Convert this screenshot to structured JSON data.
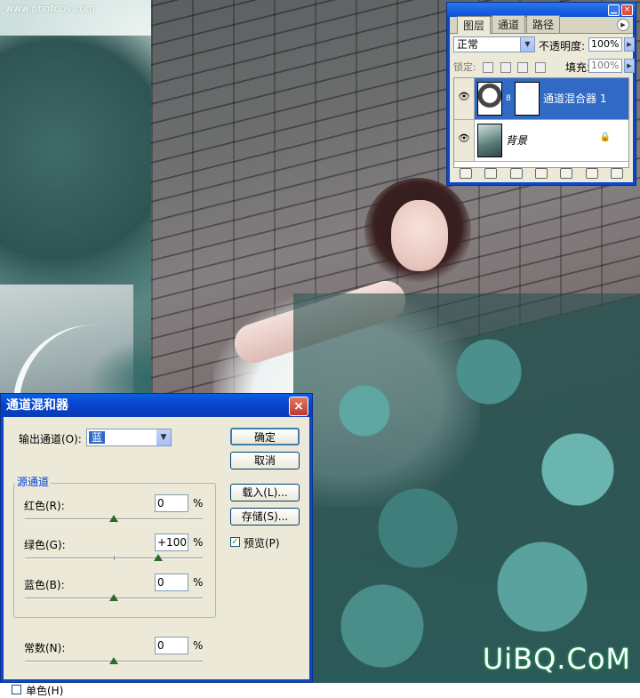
{
  "watermarks": {
    "top_url": "www.photops.com",
    "bottom_logo": "UiBQ.CoM"
  },
  "layers_panel": {
    "tabs": [
      "图层",
      "通道",
      "路径"
    ],
    "active_tab": "图层",
    "blend_mode": "正常",
    "opacity_label": "不透明度:",
    "opacity_value": "100%",
    "lock_label": "锁定:",
    "fill_label": "填充:",
    "fill_value": "100%",
    "layers": [
      {
        "name": "通道混合器 1",
        "selected": true,
        "thumb_icon": "adjustment-layer-icon",
        "has_mask": true
      },
      {
        "name": "背景",
        "selected": false,
        "thumb_icon": "photo-thumbnail",
        "locked": true
      }
    ],
    "window_controls": [
      "minimize",
      "close"
    ]
  },
  "channel_mixer": {
    "title": "通道混和器",
    "output_channel_label": "输出通道(O):",
    "output_channel_value": "蓝",
    "source_group_label": "源通道",
    "sliders": [
      {
        "key": "red",
        "label": "红色(R):",
        "value": "0",
        "unit": "%",
        "level": 0
      },
      {
        "key": "green",
        "label": "绿色(G):",
        "value": "+100",
        "unit": "%",
        "level": 100
      },
      {
        "key": "blue",
        "label": "蓝色(B):",
        "value": "0",
        "unit": "%",
        "level": 0
      }
    ],
    "constant": {
      "label": "常数(N):",
      "value": "0",
      "unit": "%",
      "level": 0
    },
    "monochrome_label": "单色(H)",
    "monochrome_checked": false,
    "buttons": {
      "ok": "确定",
      "cancel": "取消",
      "load": "载入(L)...",
      "save": "存储(S)..."
    },
    "preview_label": "预览(P)",
    "preview_checked": true
  },
  "colors": {
    "xp_title_blue": "#0a47c9",
    "dialog_face": "#ece9d8",
    "selection_blue": "#316ac5",
    "group_title_blue": "#0046d5"
  }
}
